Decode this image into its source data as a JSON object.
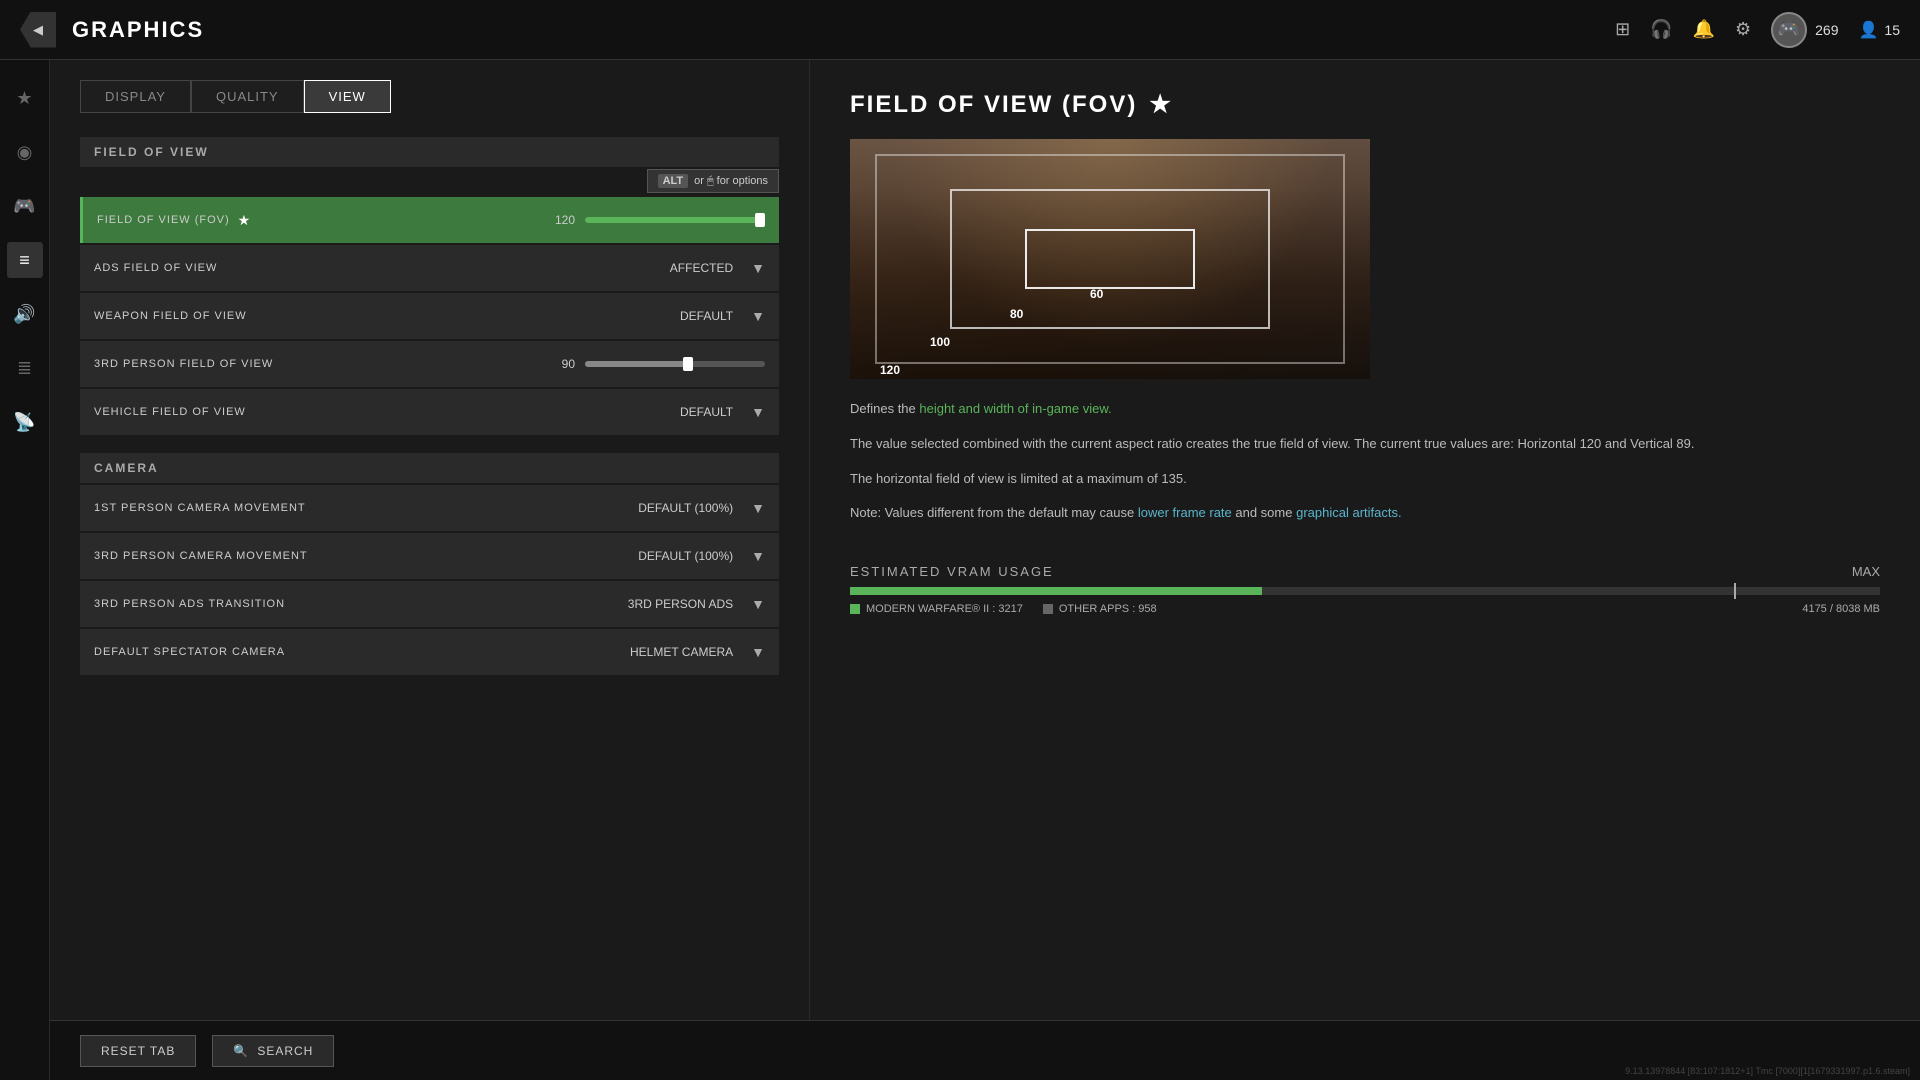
{
  "topbar": {
    "back_label": "◀",
    "title": "GRAPHICS",
    "icons": [
      "⊞",
      "🎧",
      "🔔",
      "⚙"
    ],
    "username": "269",
    "currency_icon": "👤",
    "currency_value": "15"
  },
  "sidebar": {
    "items": [
      {
        "icon": "★",
        "active": false
      },
      {
        "icon": "◉",
        "active": false
      },
      {
        "icon": "🎮",
        "active": false
      },
      {
        "icon": "≡",
        "active": true
      },
      {
        "icon": "🔊",
        "active": false
      },
      {
        "icon": "≣",
        "active": false
      },
      {
        "icon": "📡",
        "active": false
      }
    ]
  },
  "tabs": [
    {
      "label": "DISPLAY",
      "active": false
    },
    {
      "label": "QUALITY",
      "active": false
    },
    {
      "label": "VIEW",
      "active": true
    }
  ],
  "field_of_view_section": {
    "header": "FIELD OF VIEW",
    "alt_hint": "ALT or 🖱 for options",
    "settings": [
      {
        "label": "FIELD OF VIEW (FOV)",
        "has_star": true,
        "type": "slider",
        "value": "120",
        "fill_pct": 100,
        "active": true
      },
      {
        "label": "ADS FIELD OF VIEW",
        "type": "dropdown",
        "value": "AFFECTED"
      },
      {
        "label": "WEAPON FIELD OF VIEW",
        "type": "dropdown",
        "value": "DEFAULT"
      },
      {
        "label": "3RD PERSON FIELD OF VIEW",
        "type": "slider",
        "value": "90",
        "fill_pct": 60
      },
      {
        "label": "VEHICLE FIELD OF VIEW",
        "type": "dropdown",
        "value": "DEFAULT"
      }
    ]
  },
  "camera_section": {
    "header": "CAMERA",
    "settings": [
      {
        "label": "1ST PERSON CAMERA MOVEMENT",
        "type": "dropdown",
        "value": "DEFAULT (100%)"
      },
      {
        "label": "3RD PERSON CAMERA MOVEMENT",
        "type": "dropdown",
        "value": "DEFAULT (100%)"
      },
      {
        "label": "3RD PERSON ADS TRANSITION",
        "type": "dropdown",
        "value": "3RD PERSON ADS"
      },
      {
        "label": "DEFAULT SPECTATOR CAMERA",
        "type": "dropdown",
        "value": "HELMET CAMERA"
      }
    ]
  },
  "detail": {
    "title": "FIELD OF VIEW (FOV)",
    "has_star": true,
    "fov_labels": [
      "60",
      "80",
      "100",
      "120"
    ],
    "description_1": "Defines the ",
    "description_1_highlight": "height and width of in-game view.",
    "description_2": "The value selected combined with the current aspect ratio creates the true field of view. The current true values are: Horizontal 120 and Vertical 89.",
    "description_3": "The horizontal field of view is limited at a maximum of 135.",
    "description_4": "Note: Values different from the default may cause ",
    "description_4_highlight": "lower frame rate",
    "description_4_2": " and some ",
    "description_4_3": "graphical artifacts.",
    "vram": {
      "title": "ESTIMATED VRAM USAGE",
      "max_label": "MAX",
      "mw_label": "MODERN WARFARE® II : 3217",
      "other_label": "OTHER APPS : 958",
      "total": "4175 / 8038 MB",
      "fill_pct": 40,
      "marker_pct": 86
    }
  },
  "bottombar": {
    "reset_label": "RESET TAB",
    "search_label": "SEARCH",
    "search_icon": "🔍"
  },
  "version": "9.13.13978844 [83:107:1812+1] Tmc [7000][1[1679331997.p1.6.steam]"
}
